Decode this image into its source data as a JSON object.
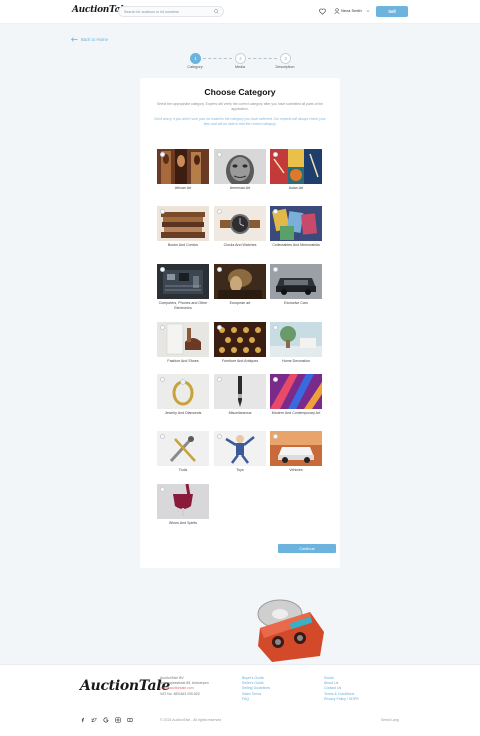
{
  "header": {
    "logo": "AuctionTale",
    "search_placeholder": "Search for auctions or lot numbers",
    "user_name": "Nexa Smith",
    "sell_label": "Sell"
  },
  "back_label": "Back to Home",
  "steps": [
    {
      "number": "1",
      "label": "Category",
      "active": true
    },
    {
      "number": "2",
      "label": "Media",
      "active": false
    },
    {
      "number": "3",
      "label": "Description",
      "active": false
    }
  ],
  "card": {
    "title": "Choose Category",
    "subtitle": "Select the appropriate category. Experts will verify the correct category after you have submitted all parts of the application.",
    "note": "Don't worry, if you aren't sure your lot matches the category you have selected. Our experts will always check your item and will be able to find the correct category."
  },
  "categories": [
    {
      "label": "African Art",
      "icon": "african-art-thumbnail"
    },
    {
      "label": "American Art",
      "icon": "american-art-thumbnail"
    },
    {
      "label": "Asian Art",
      "icon": "asian-art-thumbnail"
    },
    {
      "label": "Books And Comics",
      "icon": "books-thumbnail"
    },
    {
      "label": "Clocks And Watches",
      "icon": "watch-thumbnail"
    },
    {
      "label": "Collectables And Memorabilia",
      "icon": "collectables-thumbnail"
    },
    {
      "label": "Computers, Phones and Other Electronics",
      "icon": "electronics-thumbnail"
    },
    {
      "label": "European art",
      "icon": "european-art-thumbnail"
    },
    {
      "label": "Exclusive Cars",
      "icon": "car-thumbnail"
    },
    {
      "label": "Fashion And Shoes",
      "icon": "fashion-thumbnail"
    },
    {
      "label": "Furniture And Antiques",
      "icon": "furniture-thumbnail"
    },
    {
      "label": "Home Decoration",
      "icon": "home-decoration-thumbnail"
    },
    {
      "label": "Jewelry And Diamonds",
      "icon": "ring-thumbnail"
    },
    {
      "label": "Miscellaneous",
      "icon": "pen-thumbnail"
    },
    {
      "label": "Modern And Contemporary Art",
      "icon": "modern-art-thumbnail"
    },
    {
      "label": "Tools",
      "icon": "tools-thumbnail"
    },
    {
      "label": "Toys",
      "icon": "toys-thumbnail"
    },
    {
      "label": "Vehicles",
      "icon": "vehicle-thumbnail"
    },
    {
      "label": "Wines And Spirits",
      "icon": "wine-thumbnail"
    }
  ],
  "continue_label": "Continue",
  "footer": {
    "logo": "AuctionTale",
    "company": {
      "line1": "AuctionTale BV",
      "line2": "Antwerpsestraat 85, Antwerpen",
      "line3": "info@auctiontale.com",
      "line4": "VAT No. BE0463.290.520"
    },
    "links_1": [
      "Buyer's Guide",
      "Seller's Guide",
      "Selling Guidelines",
      "Sales Terms",
      "FAQ"
    ],
    "links_2": [
      "Social",
      "About Us",
      "Contact Us",
      "Terms & Conditions",
      "Privacy Policy / GDPR"
    ],
    "copyright": "© 2024 AuctionTale - All rights reserved",
    "language": "Select Lang"
  },
  "colors": {
    "accent": "#6cb4de",
    "background": "#f3f6f9",
    "link_red": "#e46e6e"
  }
}
